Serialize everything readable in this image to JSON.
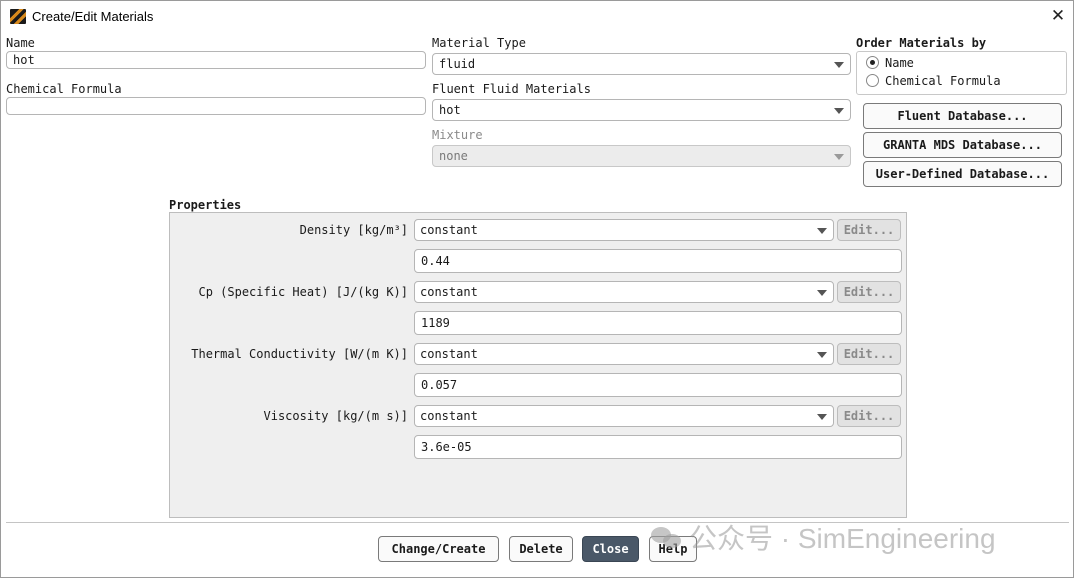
{
  "window": {
    "title": "Create/Edit Materials"
  },
  "name": {
    "label": "Name",
    "value": "hot"
  },
  "chemical_formula": {
    "label": "Chemical Formula",
    "value": ""
  },
  "material_type": {
    "label": "Material Type",
    "value": "fluid"
  },
  "fluent_materials": {
    "label": "Fluent Fluid Materials",
    "value": "hot"
  },
  "mixture": {
    "label": "Mixture",
    "value": "none"
  },
  "order_by": {
    "label": "Order Materials by",
    "options": [
      "Name",
      "Chemical Formula"
    ],
    "selected": "Name"
  },
  "databases": {
    "fluent": "Fluent Database...",
    "granta": "GRANTA MDS Database...",
    "user_defined": "User-Defined Database..."
  },
  "properties": {
    "title": "Properties",
    "edit_label": "Edit...",
    "items": [
      {
        "label": "Density [kg/m³]",
        "method": "constant",
        "value": "0.44"
      },
      {
        "label": "Cp (Specific Heat) [J/(kg K)]",
        "method": "constant",
        "value": "1189"
      },
      {
        "label": "Thermal Conductivity [W/(m K)]",
        "method": "constant",
        "value": "0.057"
      },
      {
        "label": "Viscosity [kg/(m s)]",
        "method": "constant",
        "value": "3.6e-05"
      }
    ]
  },
  "footer": {
    "change_create": "Change/Create",
    "delete": "Delete",
    "close": "Close",
    "help": "Help"
  },
  "watermark": {
    "text": "公众号 · SimEngineering"
  }
}
